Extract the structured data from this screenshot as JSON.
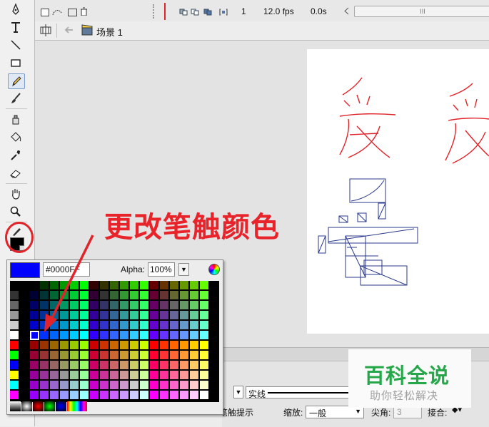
{
  "timeline": {
    "frame_number": "1",
    "fps": "12.0 fps",
    "time": "0.0s",
    "scroll_thumb": "III"
  },
  "editbar": {
    "scene_label": "场景 1"
  },
  "tools": [
    {
      "name": "subselection-tool-icon",
      "icon": "pen-arrow"
    },
    {
      "name": "text-tool-icon",
      "icon": "T"
    },
    {
      "name": "line-tool-icon",
      "icon": "line"
    },
    {
      "name": "rectangle-tool-icon",
      "icon": "rect"
    },
    {
      "name": "pencil-tool-icon",
      "icon": "pencil"
    },
    {
      "name": "brush-tool-icon",
      "icon": "brush"
    },
    {
      "name": "ink-bottle-tool-icon",
      "icon": "ink-bottle"
    },
    {
      "name": "paint-bucket-tool-icon",
      "icon": "bucket"
    },
    {
      "name": "eyedropper-tool-icon",
      "icon": "eyedropper"
    },
    {
      "name": "eraser-tool-icon",
      "icon": "eraser"
    },
    {
      "name": "hand-tool-icon",
      "icon": "hand"
    },
    {
      "name": "zoom-tool-icon",
      "icon": "magnifier"
    }
  ],
  "color_picker": {
    "hex_value": "#0000FF",
    "alpha_label": "Alpha:",
    "alpha_value": "100%",
    "current_color": "#0000ff"
  },
  "annotation": {
    "text": "更改笔触颜色",
    "color": "#e8232a"
  },
  "properties": {
    "stroke_style": "实线",
    "hinting_label": "笔触提示",
    "scale_label": "缩放:",
    "scale_value": "一般",
    "corner_label": "尖角:",
    "corner_value": "3",
    "join_label": "接合:"
  },
  "watermark": {
    "title": "百科全说",
    "subtitle": "助你轻松解决"
  },
  "colors": {
    "stroke_red": "#e0242a",
    "stroke_blue": "#2a3a8c",
    "selected_fill": "#0000ff"
  }
}
